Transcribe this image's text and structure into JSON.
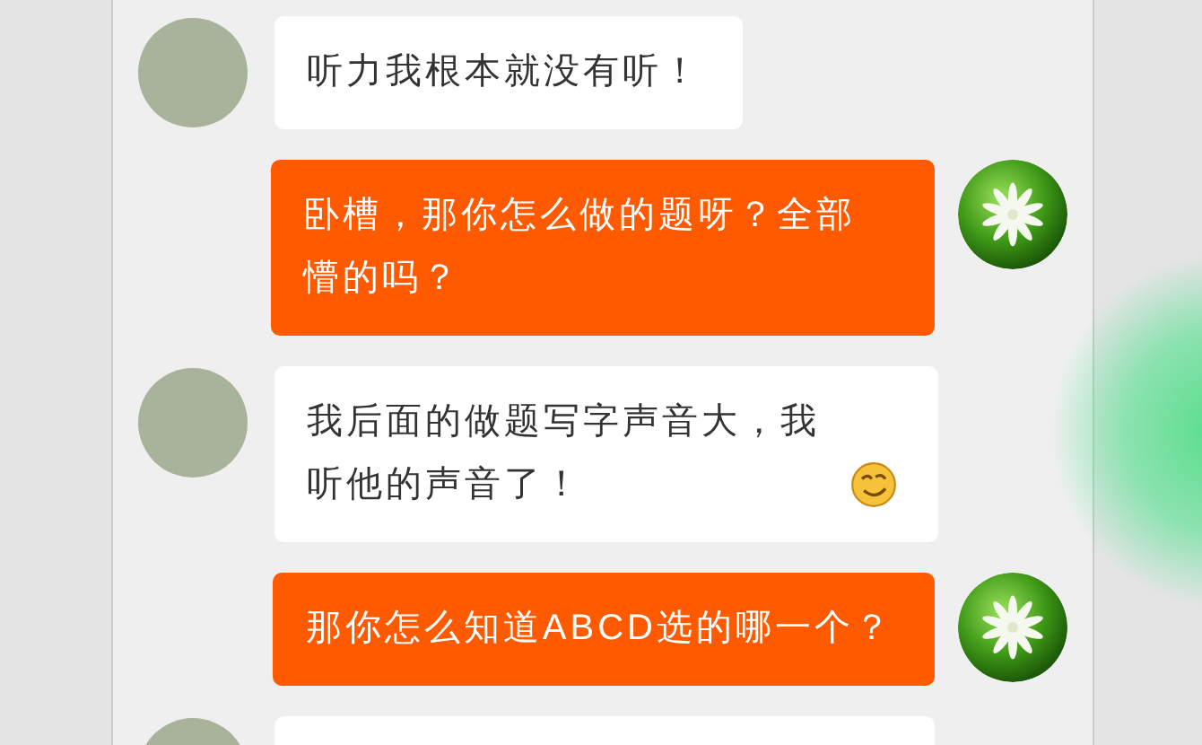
{
  "messages": [
    {
      "kind": "incoming",
      "text": "听力我根本就没有听！",
      "emoji": false
    },
    {
      "kind": "outgoing",
      "text": "卧槽，那你怎么做的题呀？全部懵的吗？",
      "emoji": false
    },
    {
      "kind": "incoming",
      "text": "我后面的做题写字声音大，我听他的声音了！",
      "emoji": true
    },
    {
      "kind": "outgoing",
      "text": "那你怎么知道ABCD选的哪一个？",
      "emoji": false
    },
    {
      "kind": "incoming",
      "emoji": false
    }
  ]
}
